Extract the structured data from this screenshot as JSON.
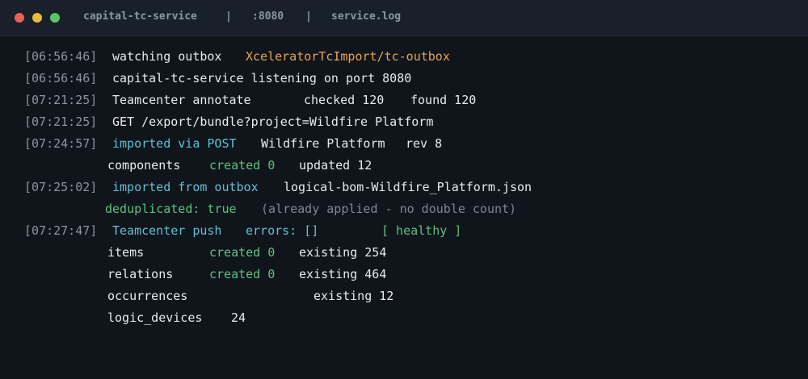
{
  "titlebar": {
    "service": "capital-tc-service",
    "sep": "|",
    "port": ":8080",
    "file": "service.log"
  },
  "lines": [
    {
      "ts": "[06:56:46]",
      "a": "watching outbox",
      "b": "XceleratorTcImport/tc-outbox"
    },
    {
      "ts": "[06:56:46]",
      "a": "capital-tc-service listening on port 8080"
    },
    {
      "ts": "[07:21:25]",
      "a": "Teamcenter annotate",
      "b": "checked 120",
      "c": "found 120"
    },
    {
      "ts": "[07:21:25]",
      "a": "GET /export/bundle?project=Wildfire Platform"
    },
    {
      "ts": "[07:24:57]",
      "a": "imported via POST",
      "b": "Wildfire Platform",
      "c": "rev 8"
    },
    {
      "a": "components",
      "b": "created 0",
      "c": "updated 12"
    },
    {
      "ts": "[07:25:02]",
      "a": "imported from outbox",
      "b": "logical-bom-Wildfire_Platform.json"
    },
    {
      "a": "deduplicated: true",
      "b": "(already applied - no double count)"
    },
    {
      "ts": "[07:27:47]",
      "a": "Teamcenter push",
      "b": "errors: []",
      "c": "[ healthy ]"
    },
    {
      "a": "items",
      "b": "created 0",
      "c": "existing 254"
    },
    {
      "a": "relations",
      "b": "created 0",
      "c": "existing 464"
    },
    {
      "a": "occurrences",
      "c": "existing 12"
    },
    {
      "a": "logic_devices",
      "b": "24"
    }
  ]
}
